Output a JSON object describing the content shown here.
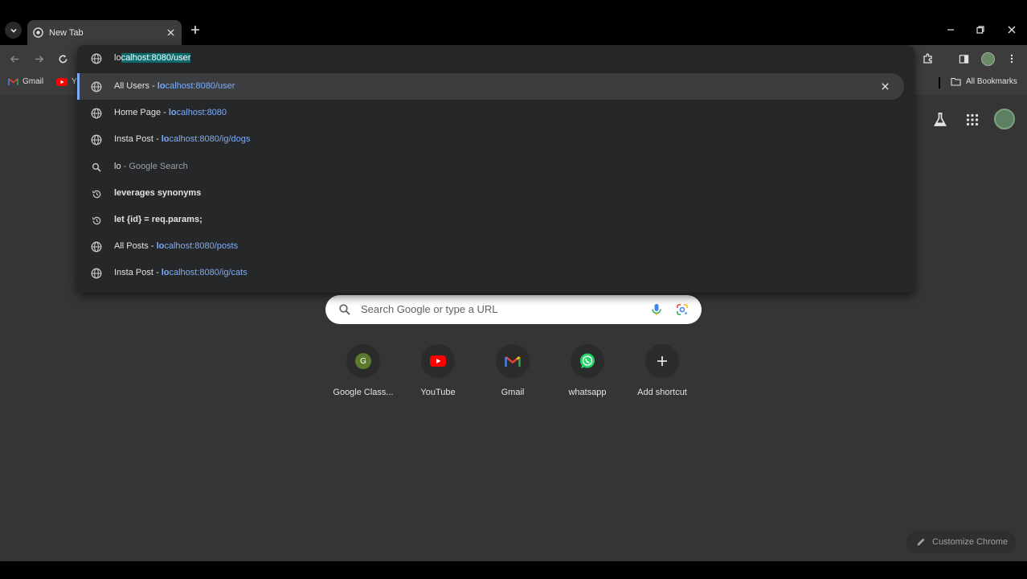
{
  "tab": {
    "title": "New Tab"
  },
  "omnibox": {
    "typed": "lo",
    "completion": "calhost:8080/user",
    "suggestions": [
      {
        "icon": "globe-icon",
        "title": "All Users",
        "sep": " - ",
        "url_bold": "lo",
        "url_rest": "calhost:8080/user",
        "highlighted": true
      },
      {
        "icon": "globe-icon",
        "title": "Home Page",
        "sep": " - ",
        "url_bold": "lo",
        "url_rest": "calhost:8080"
      },
      {
        "icon": "globe-icon",
        "title": "Insta Post",
        "sep": " - ",
        "url_bold": "lo",
        "url_rest": "calhost:8080/ig/dogs"
      },
      {
        "icon": "search-icon",
        "query": "lo",
        "suffix": " - Google Search"
      },
      {
        "icon": "history-icon",
        "bold_text": "leverages synonyms"
      },
      {
        "icon": "history-icon",
        "bold_text": "let {id} = req.params;"
      },
      {
        "icon": "globe-icon",
        "title": "All Posts",
        "sep": " - ",
        "url_bold": "lo",
        "url_rest": "calhost:8080/posts"
      },
      {
        "icon": "globe-icon",
        "title": "Insta Post",
        "sep": " - ",
        "url_bold": "lo",
        "url_rest": "calhost:8080/ig/cats"
      }
    ]
  },
  "bookmarks": {
    "gmail": "Gmail",
    "youtube_partial": "Y",
    "all_bookmarks": "All Bookmarks"
  },
  "search": {
    "placeholder": "Search Google or type a URL"
  },
  "shortcuts": [
    {
      "label": "Google Class...",
      "icon": "google-classroom-icon",
      "letter": "G"
    },
    {
      "label": "YouTube",
      "icon": "youtube-icon"
    },
    {
      "label": "Gmail",
      "icon": "gmail-icon"
    },
    {
      "label": "whatsapp",
      "icon": "whatsapp-icon"
    },
    {
      "label": "Add shortcut",
      "icon": "plus-icon"
    }
  ],
  "customize": {
    "label": "Customize Chrome"
  },
  "colors": {
    "url_blue": "#7cacf8",
    "selection": "#0f6b6d",
    "page_bg": "#353535"
  }
}
